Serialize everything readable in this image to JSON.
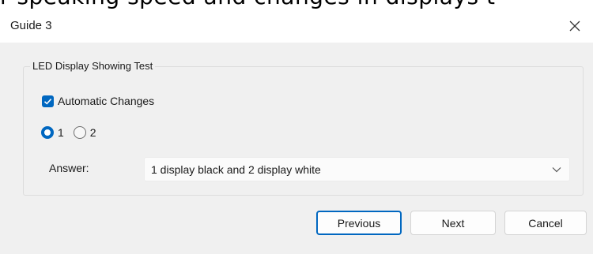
{
  "background_text": "r speaking speed and changes in displays t",
  "window": {
    "title": "Guide 3",
    "close_icon": "close-icon"
  },
  "group": {
    "title": "LED Display Showing Test"
  },
  "checkbox": {
    "label": "Automatic Changes",
    "checked": true
  },
  "radios": [
    {
      "label": "1",
      "selected": true
    },
    {
      "label": "2",
      "selected": false
    }
  ],
  "answer": {
    "label": "Answer:",
    "value": "1 display black and 2 display white"
  },
  "buttons": {
    "previous": "Previous",
    "next": "Next",
    "cancel": "Cancel"
  },
  "colors": {
    "accent": "#0067c0",
    "dialog_bg": "#f0f0f0",
    "titlebar_bg": "#ffffff"
  }
}
